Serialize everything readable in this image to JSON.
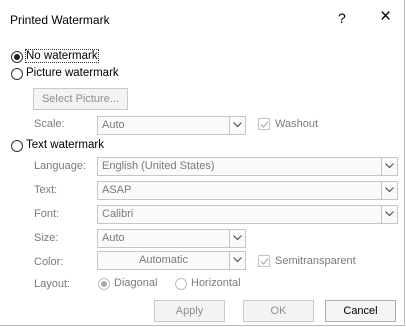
{
  "dialog": {
    "title": "Printed Watermark",
    "help": "?",
    "close": "×"
  },
  "options": {
    "no_watermark": "No watermark",
    "picture_watermark": "Picture watermark",
    "text_watermark": "Text watermark"
  },
  "picture": {
    "select_button": "Select Picture...",
    "scale_label": "Scale:",
    "scale_value": "Auto",
    "washout_label": "Washout",
    "washout_checked": true
  },
  "text": {
    "language_label": "Language:",
    "language_value": "English (United States)",
    "text_label": "Text:",
    "text_value": "ASAP",
    "font_label": "Font:",
    "font_value": "Calibri",
    "size_label": "Size:",
    "size_value": "Auto",
    "color_label": "Color:",
    "color_value": "Automatic",
    "semitransparent_label": "Semitransparent",
    "semitransparent_checked": true,
    "layout_label": "Layout:",
    "layout_diagonal": "Diagonal",
    "layout_horizontal": "Horizontal"
  },
  "buttons": {
    "apply": "Apply",
    "ok": "OK",
    "cancel": "Cancel"
  }
}
